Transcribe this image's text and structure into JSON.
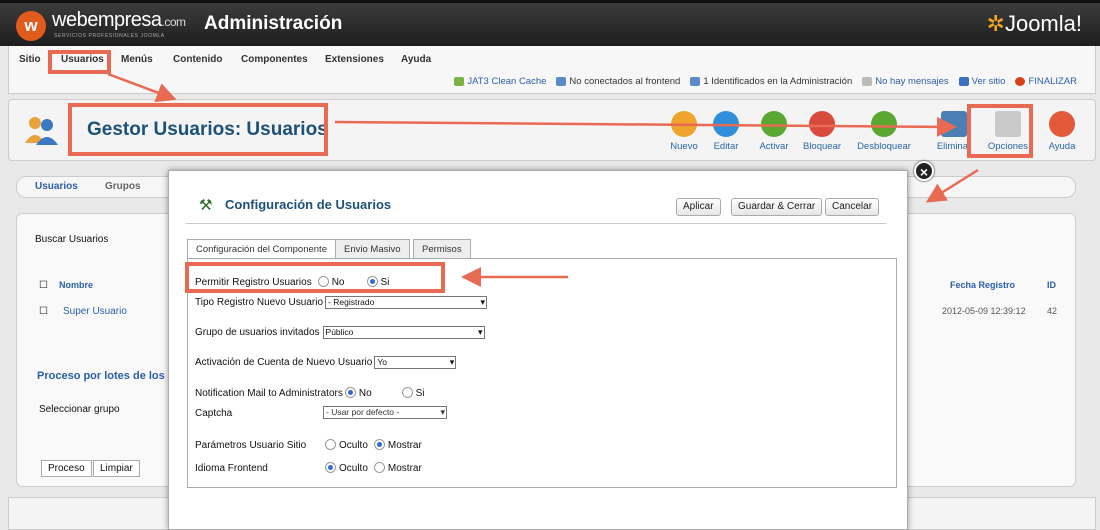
{
  "header": {
    "brand": "webempresa",
    "brand_suffix": ".com",
    "brand_sub": "SERVICIOS PROFESIONALES JOOMLA",
    "title": "Administración",
    "cms_logo": "Joomla!"
  },
  "menu": {
    "items": [
      "Sitio",
      "Usuarios",
      "Menús",
      "Contenido",
      "Componentes",
      "Extensiones",
      "Ayuda"
    ]
  },
  "status": {
    "cache": "JAT3 Clean Cache",
    "frontend": "No conectados al frontend",
    "admin": "1 Identificados en la Administración",
    "messages": "No hay mensajes",
    "site": "Ver sitio",
    "logout": "FINALIZAR"
  },
  "page": {
    "title": "Gestor Usuarios: Usuarios"
  },
  "toolbar": {
    "buttons": [
      "Nuevo",
      "Editar",
      "Activar",
      "Bloquear",
      "Desbloquear",
      "Eliminar",
      "Opciones",
      "Ayuda"
    ]
  },
  "subtabs": [
    "Usuarios",
    "Grupos"
  ],
  "filter": {
    "search_label": "Buscar Usuarios"
  },
  "table": {
    "col_name": "Nombre",
    "col_registered": "Fecha Registro",
    "col_id": "ID",
    "row_name": "Super Usuario",
    "row_date": "2012-05-09 12:39:12",
    "row_id": "42"
  },
  "batch": {
    "title": "Proceso por lotes de los",
    "select_group": "Seleccionar grupo",
    "process": "Proceso",
    "clear": "Limpiar"
  },
  "modal": {
    "title": "Configuración de Usuarios",
    "apply": "Aplicar",
    "save_close": "Guardar & Cerrar",
    "cancel": "Cancelar",
    "tabs": [
      "Configuración del Componente",
      "Envio Masivo",
      "Permisos"
    ],
    "allow_registration": "Permitir Registro Usuarios",
    "no": "No",
    "si": "Si",
    "new_user_type": "Tipo Registro Nuevo Usuario",
    "new_user_type_value": "- Registrado",
    "guest_group": "Grupo de usuarios invitados",
    "guest_group_value": "Público",
    "activation": "Activación de Cuenta de Nuevo Usuario",
    "activation_value": "Yo",
    "notification": "Notification Mail to Administrators",
    "captcha": "Captcha",
    "captcha_value": "- Usar por defecto -",
    "site_params": "Parámetros Usuario Sitio",
    "hidden": "Oculto",
    "show": "Mostrar",
    "frontend_lang": "Idioma Frontend"
  },
  "colors": {
    "accent": "#e96a52",
    "title_blue": "#1d5178"
  }
}
